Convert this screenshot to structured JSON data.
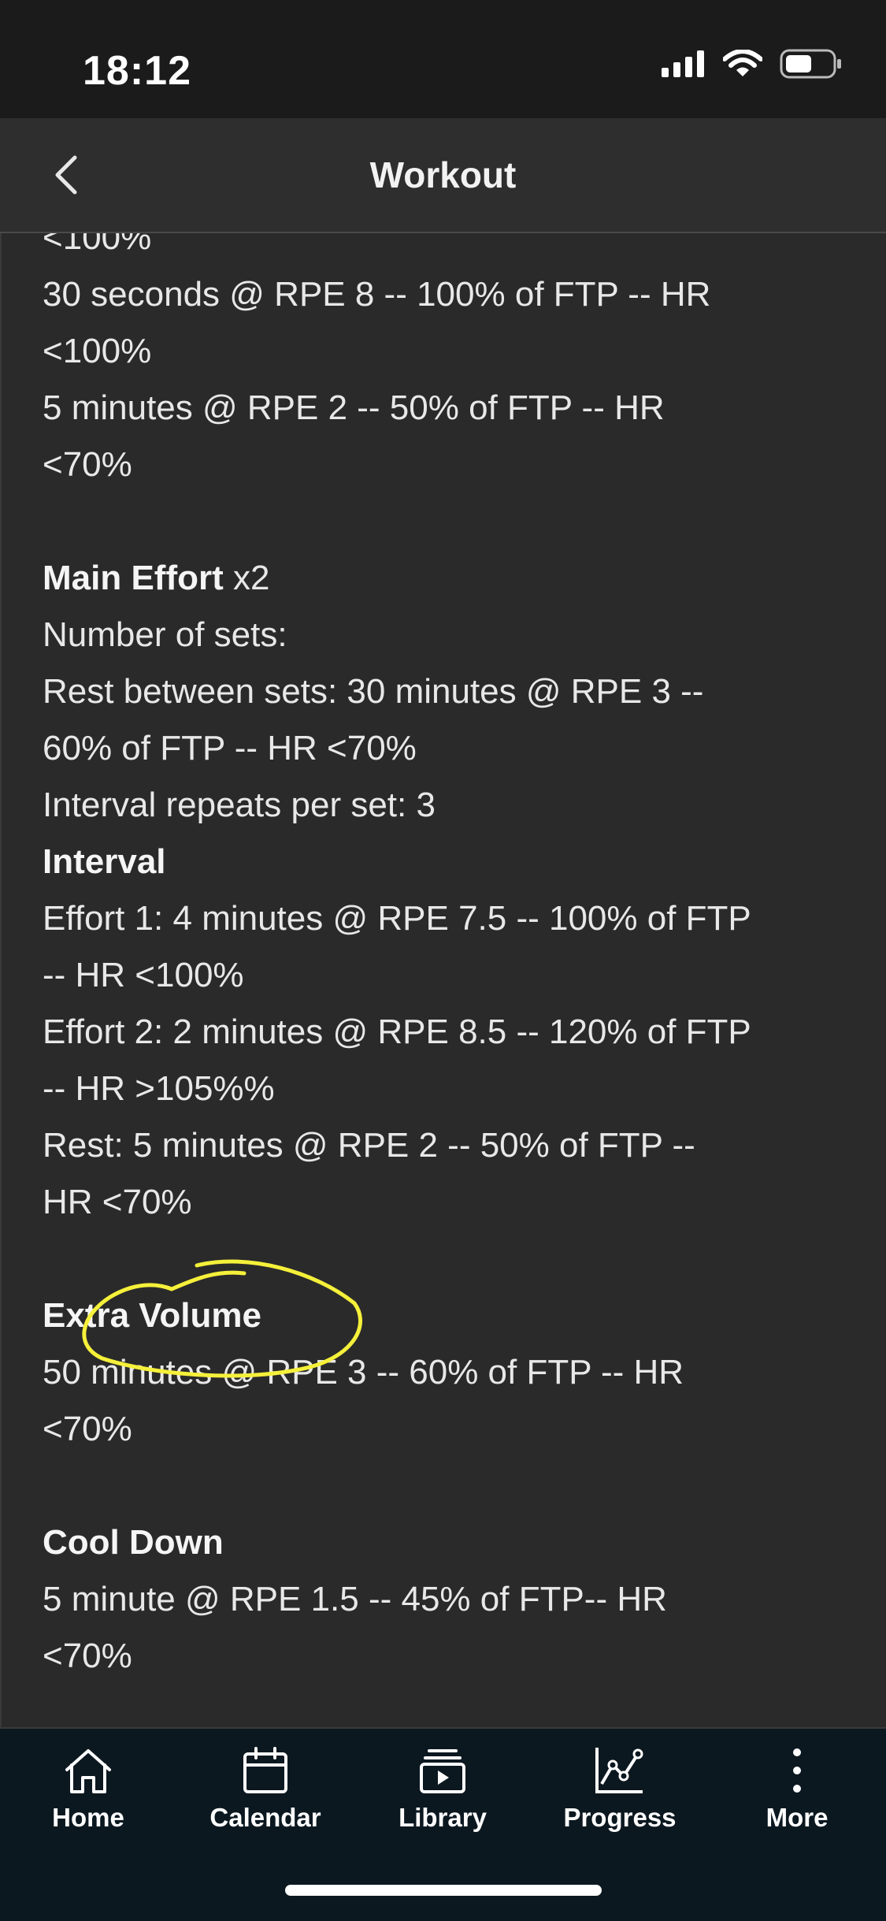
{
  "status_bar": {
    "time": "18:12"
  },
  "header": {
    "title": "Workout"
  },
  "workout": {
    "cutoff_line": "<100%",
    "warmup_lines": [
      "30 seconds @ RPE 8 -- 100% of FTP -- HR",
      "<100%",
      "5 minutes @ RPE 2 -- 50% of FTP -- HR",
      "<70%"
    ],
    "main_effort": {
      "title": "Main Effort",
      "multiplier": "x2",
      "number_of_sets": "Number of sets:",
      "rest_between_sets": [
        "Rest between sets: 30 minutes @ RPE 3 --",
        "60% of FTP -- HR <70%"
      ],
      "interval_repeats": "Interval repeats per set: 3",
      "interval_title": "Interval",
      "effort1": [
        "Effort 1: 4 minutes @ RPE 7.5 -- 100% of FTP",
        "-- HR <100%"
      ],
      "effort2": [
        "Effort 2: 2 minutes @ RPE 8.5 -- 120% of FTP",
        "-- HR >105%%"
      ],
      "rest": [
        "Rest: 5 minutes @ RPE 2 -- 50% of FTP --",
        "HR <70%"
      ]
    },
    "extra_volume": {
      "title": "Extra Volume",
      "lines": [
        "50 minutes @ RPE 3 -- 60% of FTP -- HR",
        "<70%"
      ]
    },
    "cool_down": {
      "title": "Cool Down",
      "lines": [
        "5 minute @ RPE 1.5 -- 45% of FTP-- HR",
        "<70%"
      ]
    }
  },
  "tabs": [
    {
      "label": "Home",
      "icon": "home-icon"
    },
    {
      "label": "Calendar",
      "icon": "calendar-icon"
    },
    {
      "label": "Library",
      "icon": "library-icon"
    },
    {
      "label": "Progress",
      "icon": "progress-icon"
    },
    {
      "label": "More",
      "icon": "more-icon"
    }
  ],
  "colors": {
    "background": "#2a2a2a",
    "status_bar": "#1b1b1b",
    "nav_bar": "#2e2e2e",
    "tab_bar": "#0c1820",
    "annotation": "#f5f03a",
    "text": "#e8e8e8"
  }
}
